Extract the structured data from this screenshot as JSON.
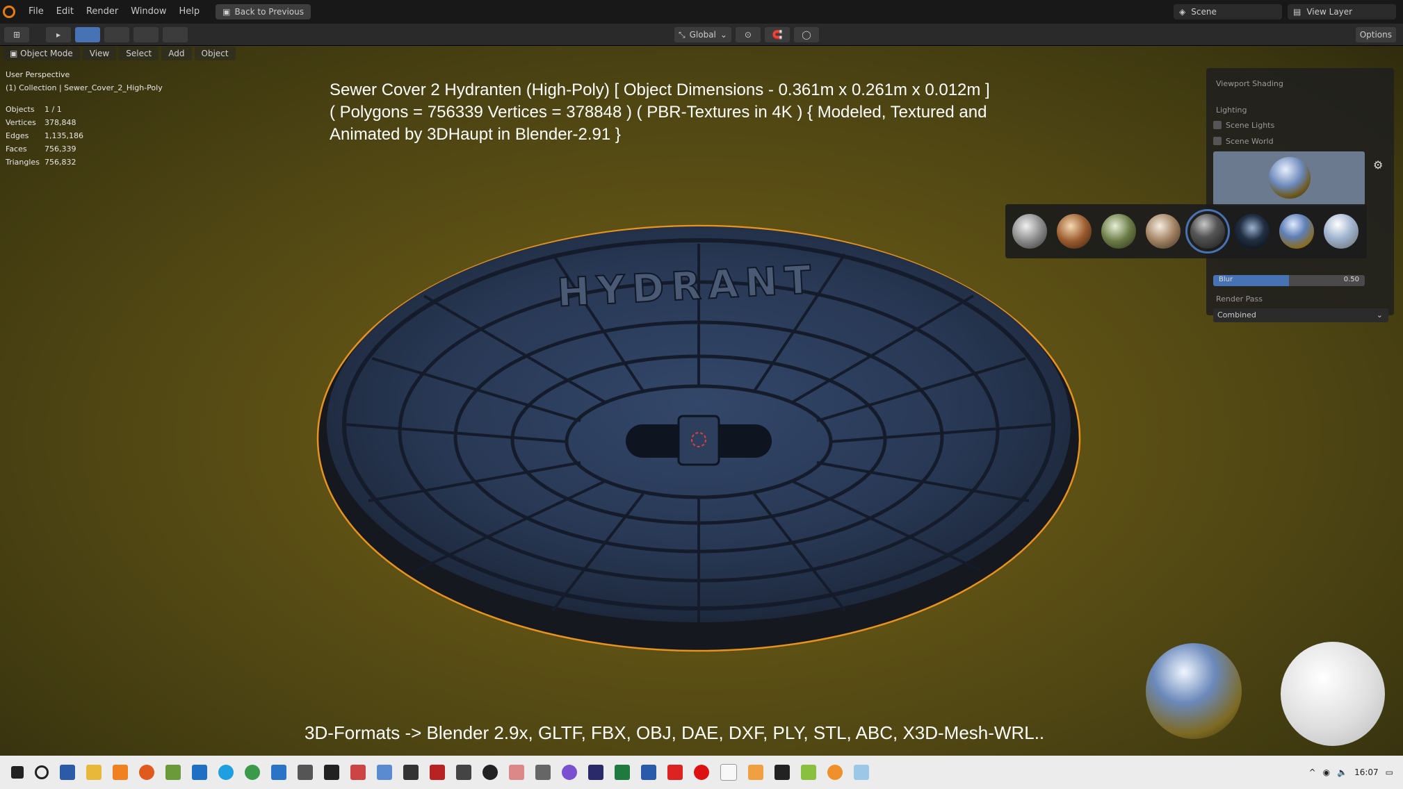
{
  "menu": {
    "items": [
      "File",
      "Edit",
      "Render",
      "Window",
      "Help"
    ],
    "back_label": "Back to Previous"
  },
  "top_right": {
    "scene": "Scene",
    "view_layer": "View Layer"
  },
  "toolbar": {
    "transform": "Global",
    "options": "Options"
  },
  "viewport_header": {
    "mode": "Object Mode",
    "items": [
      "View",
      "Select",
      "Add",
      "Object"
    ]
  },
  "stats": {
    "perspective": "User Perspective",
    "collection": "(1) Collection | Sewer_Cover_2_High-Poly",
    "rows": [
      {
        "k": "Objects",
        "v": "1 / 1"
      },
      {
        "k": "Vertices",
        "v": "378,848"
      },
      {
        "k": "Edges",
        "v": "1,135,186"
      },
      {
        "k": "Faces",
        "v": "756,339"
      },
      {
        "k": "Triangles",
        "v": "756,832"
      }
    ]
  },
  "overlay": {
    "line1": "Sewer Cover 2 Hydranten (High-Poly) [ Object Dimensions -  0.361m x 0.261m x 0.012m ]",
    "line2": "( Polygons = 756339 Vertices = 378848 ) ( PBR-Textures in 4K ) { Modeled, Textured and",
    "line3": "Animated by 3DHaupt in Blender-2.91 }",
    "bottom": "3D-Formats -> Blender 2.9x, GLTF, FBX, OBJ, DAE, DXF, PLY, STL, ABC, X3D-Mesh-WRL.."
  },
  "cover": {
    "emboss": "HYDRANT"
  },
  "shading": {
    "title": "Viewport Shading",
    "lighting": "Lighting",
    "scene_lights": "Scene Lights",
    "scene_world": "Scene World",
    "blur_label": "Blur",
    "blur_value": "0.50",
    "blur_fraction": 0.5,
    "render_pass": "Render Pass",
    "combined": "Combined"
  },
  "tray": {
    "time": "16:07"
  },
  "colors": {
    "accent": "#4772b3",
    "selection_outline": "#e8931f",
    "cover": "#2b3a55"
  }
}
